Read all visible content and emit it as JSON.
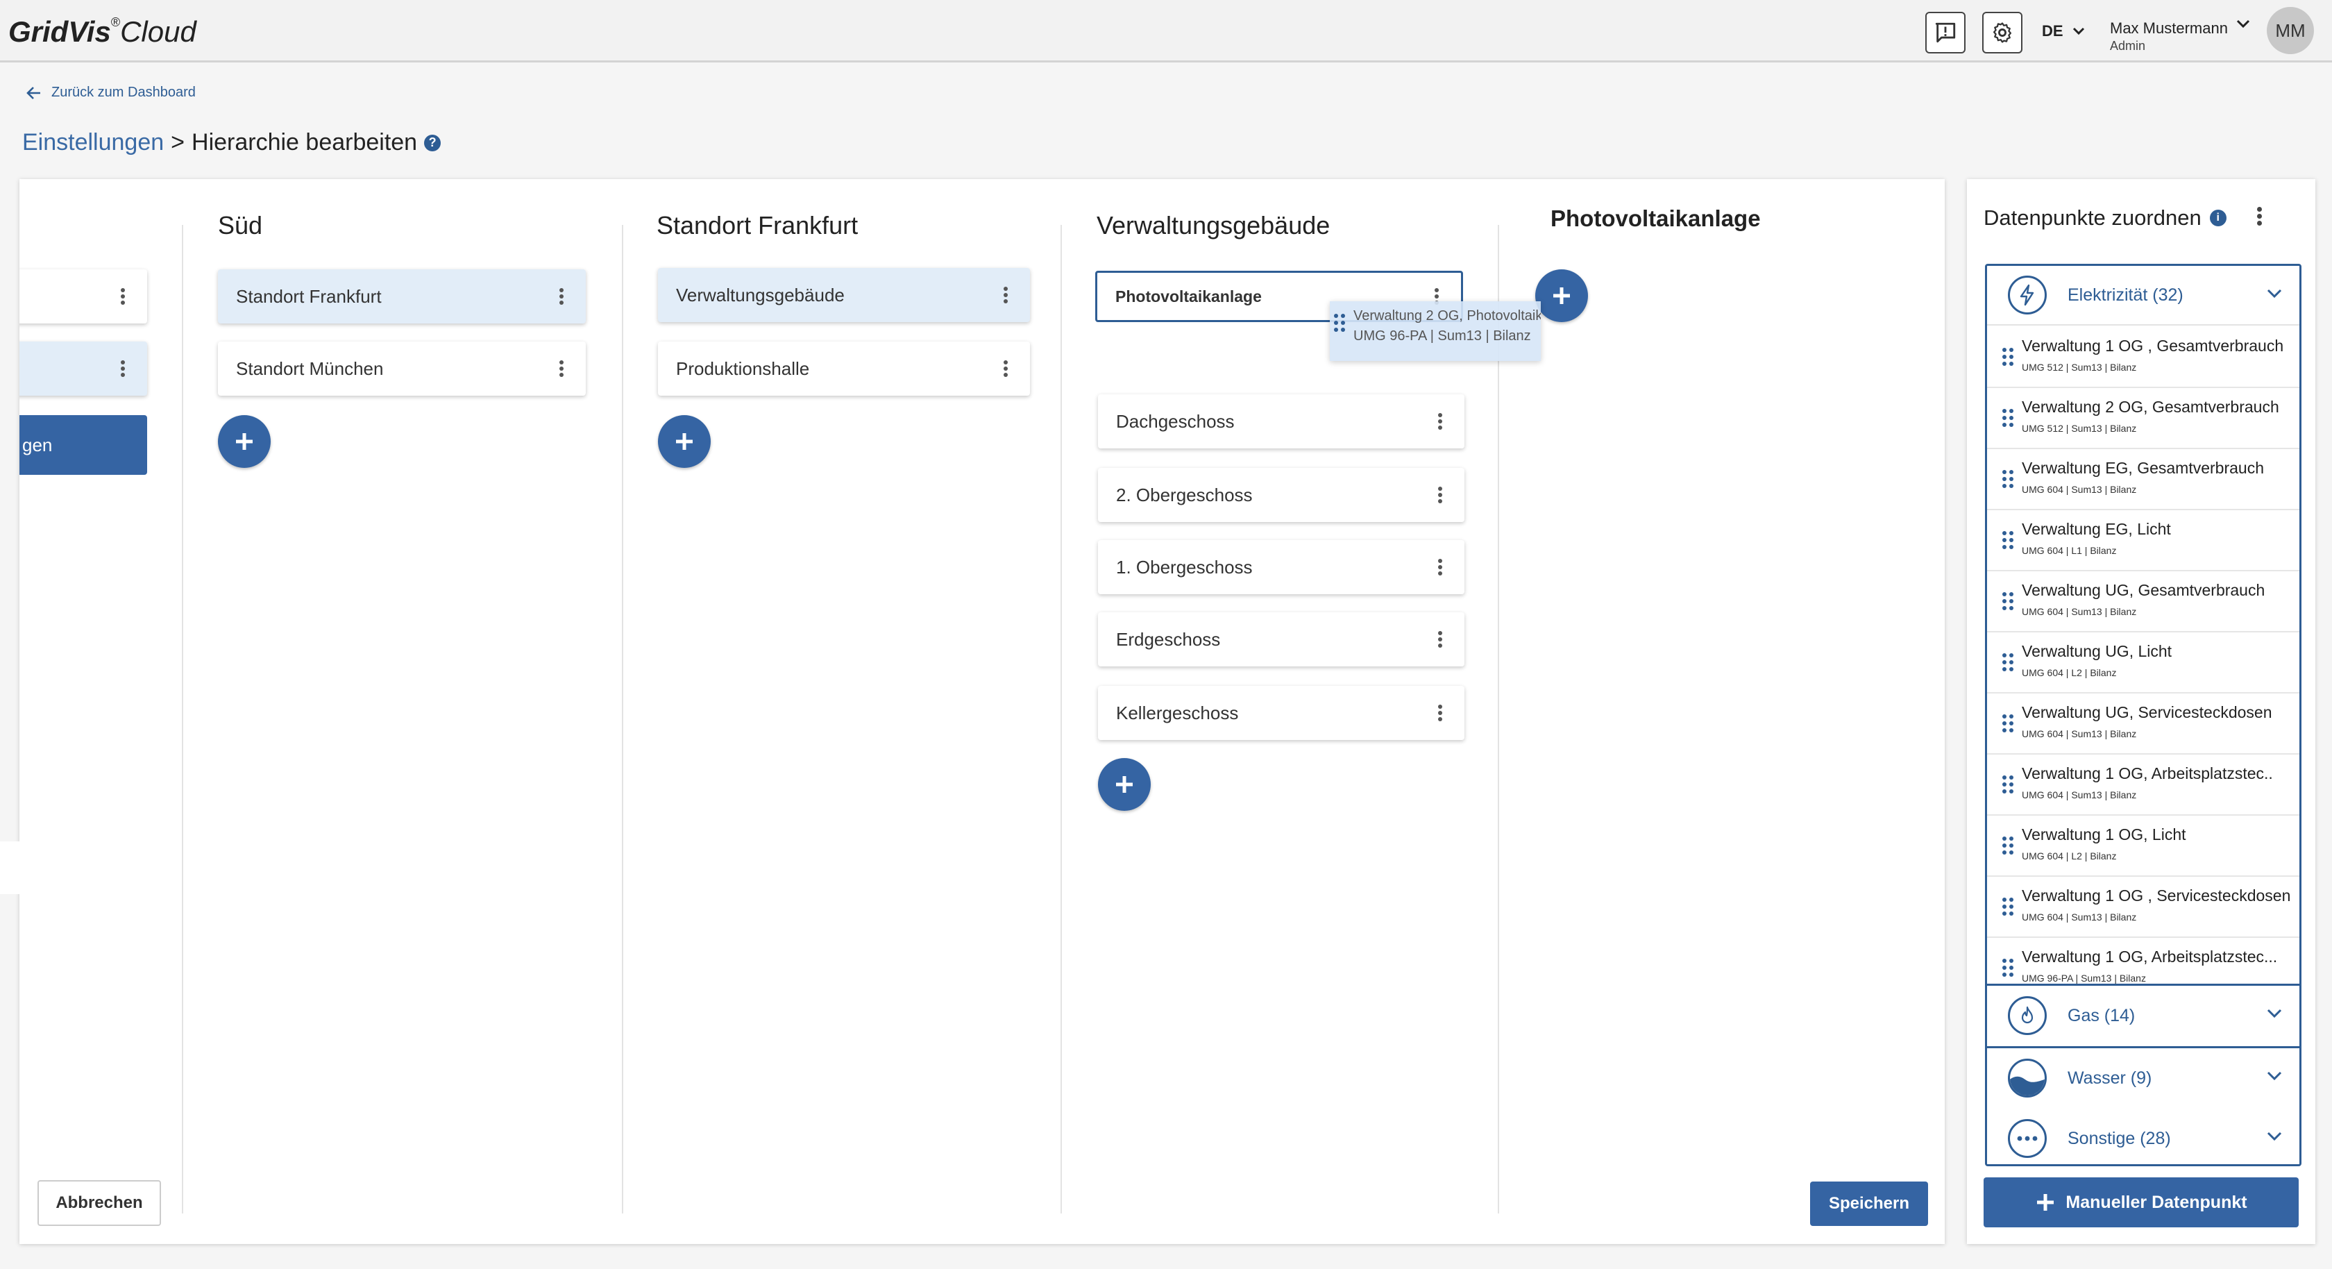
{
  "app": {
    "logo_main": "GridVis",
    "logo_reg": "®",
    "logo_sub": "Cloud"
  },
  "header": {
    "lang": "DE",
    "user_name": "Max Mustermann",
    "user_role": "Admin",
    "avatar": "MM"
  },
  "nav": {
    "back_label": "Zurück zum Dashboard"
  },
  "breadcrumb": {
    "parent": "Einstellungen",
    "separator": ">",
    "current": "Hierarchie bearbeiten",
    "help": "?"
  },
  "columns": {
    "left_partial": {
      "button_text": "gen"
    },
    "sued": {
      "title": "Süd",
      "items": [
        "Standort Frankfurt",
        "Standort München"
      ]
    },
    "frankfurt": {
      "title": "Standort Frankfurt",
      "items": [
        "Verwaltungsgebäude",
        "Produktionshalle"
      ]
    },
    "verwaltung": {
      "title": "Verwaltungsgebäude",
      "items": [
        "Photovoltaikanlage",
        "Dachgeschoss",
        "2. Obergeschoss",
        "1. Obergeschoss",
        "Erdgeschoss",
        "Kellergeschoss"
      ]
    },
    "pv": {
      "title": "Photovoltaikanlage"
    }
  },
  "drag_ghost": {
    "line1": "Verwaltung 2 OG, Photovoltaik...",
    "line2": "UMG 96-PA | Sum13 | Bilanz"
  },
  "actions": {
    "cancel": "Abbrechen",
    "save": "Speichern"
  },
  "datapoints": {
    "title": "Datenpunkte zuordnen",
    "info": "i",
    "categories": [
      {
        "label": "Elektrizität (32)",
        "icon": "lightning-icon",
        "open": true
      },
      {
        "label": "Gas (14)",
        "icon": "flame-icon"
      },
      {
        "label": "Wasser (9)",
        "icon": "water-icon"
      },
      {
        "label": "Sonstige (28)",
        "icon": "more-icon"
      }
    ],
    "items": [
      {
        "name": "Verwaltung 1 OG , Gesamtverbrauch",
        "sub": "UMG 512 | Sum13 | Bilanz"
      },
      {
        "name": "Verwaltung 2 OG, Gesamtverbrauch",
        "sub": "UMG 512 | Sum13 | Bilanz"
      },
      {
        "name": "Verwaltung EG, Gesamtverbrauch",
        "sub": "UMG 604 | Sum13 | Bilanz"
      },
      {
        "name": "Verwaltung EG, Licht",
        "sub": "UMG 604 | L1 | Bilanz"
      },
      {
        "name": "Verwaltung UG, Gesamtverbrauch",
        "sub": "UMG 604 | Sum13 | Bilanz"
      },
      {
        "name": "Verwaltung UG, Licht",
        "sub": "UMG 604 | L2 | Bilanz"
      },
      {
        "name": "Verwaltung UG, Servicesteckdosen",
        "sub": "UMG 604 | Sum13 | Bilanz"
      },
      {
        "name": "Verwaltung 1 OG, Arbeitsplatzstec..",
        "sub": "UMG 604 | Sum13 | Bilanz"
      },
      {
        "name": "Verwaltung 1 OG, Licht",
        "sub": "UMG 604 | L2 | Bilanz"
      },
      {
        "name": "Verwaltung 1 OG , Servicesteckdosen",
        "sub": "UMG 604 | Sum13 | Bilanz"
      },
      {
        "name": "Verwaltung 1 OG, Arbeitsplatzstec...",
        "sub": "UMG 96-PA | Sum13 | Bilanz"
      }
    ],
    "manual_button": "Manueller Datenpunkt"
  },
  "colors": {
    "primary": "#3564a3",
    "link": "#2e5d94",
    "selected": "#e2edf8"
  }
}
